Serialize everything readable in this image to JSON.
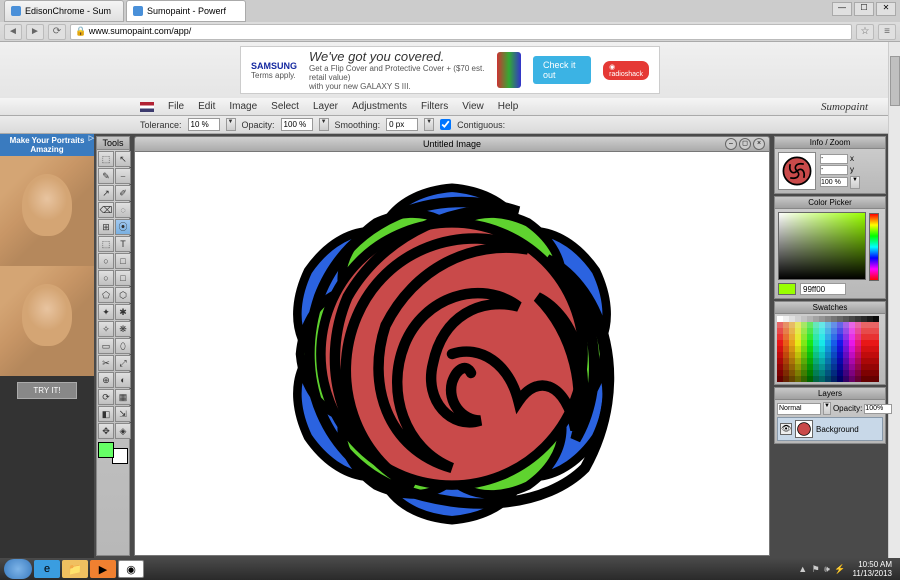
{
  "browser": {
    "tabs": [
      {
        "title": "EdisonChrome - Sum",
        "active": false
      },
      {
        "title": "Sumopaint - Powerf",
        "active": true
      }
    ],
    "url": "www.sumopaint.com/app/"
  },
  "banner_ad": {
    "brand": "SAMSUNG",
    "headline": "We've got you covered.",
    "sub": "Get a Flip Cover and Protective Cover + ($70 est. retail value)",
    "sub2": "with your new GALAXY S III.",
    "terms": "Terms apply.",
    "cta": "Check it out",
    "badge": "◉ radioshack"
  },
  "app": {
    "brand": "Sumopaint",
    "menu": [
      "File",
      "Edit",
      "Image",
      "Select",
      "Layer",
      "Adjustments",
      "Filters",
      "View",
      "Help"
    ],
    "options": {
      "tolerance_label": "Tolerance:",
      "tolerance": "10 %",
      "opacity_label": "Opacity:",
      "opacity": "100 %",
      "smoothing_label": "Smoothing:",
      "smoothing": "0 px",
      "contiguous_label": "Contiguous:",
      "contiguous": true
    }
  },
  "side_ad": {
    "headline": "Make Your Portraits Amazing",
    "cta": "TRY IT!"
  },
  "tools": {
    "title": "Tools",
    "items": [
      "⬚",
      "↖",
      "✎",
      "⎯",
      "↗",
      "✐",
      "⌫",
      "◌",
      "⊞",
      "⦿",
      "⬚",
      "T",
      "○",
      "□",
      "○",
      "□",
      "⬠",
      "⬡",
      "✦",
      "✱",
      "✧",
      "❋",
      "▭",
      "⬯",
      "✂",
      "⤢",
      "⊕",
      "◐",
      "⟳",
      "▦",
      "◧",
      "⇲",
      "✥",
      "◈"
    ]
  },
  "canvas": {
    "title": "Untitled Image"
  },
  "panels": {
    "info": {
      "title": "Info / Zoom",
      "x_label": "x",
      "x": "-",
      "y_label": "y",
      "y": "-",
      "zoom": "100 %"
    },
    "picker": {
      "title": "Color Picker",
      "current": "#99ff00",
      "hex": "99ff00"
    },
    "swatches": {
      "title": "Swatches"
    },
    "layers": {
      "title": "Layers",
      "blend": "Normal",
      "opacity_label": "Opacity:",
      "opacity": "100%",
      "rows": [
        {
          "name": "Background"
        }
      ]
    }
  },
  "taskbar": {
    "time": "10:50 AM",
    "date": "11/13/2013"
  },
  "chart_data": {
    "type": "illustration",
    "description": "Stylized spiral rose drawing",
    "fill_colors": {
      "petals": "#c94a4a",
      "leaves_outer": "#2b63e0",
      "leaves_inner": "#5fd32f",
      "outline": "#000000"
    }
  }
}
